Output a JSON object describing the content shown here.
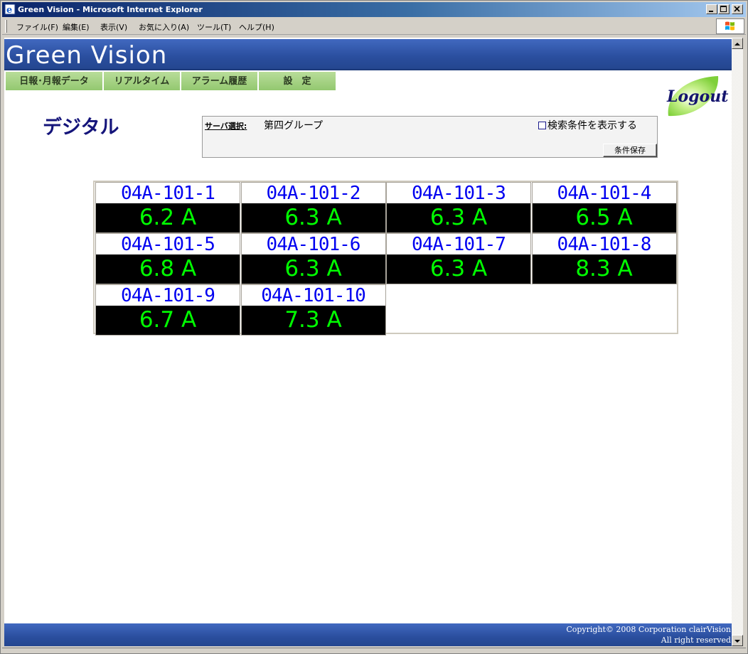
{
  "window": {
    "title": "Green Vision - Microsoft Internet Explorer"
  },
  "menubar": {
    "items": [
      "ファイル(F)",
      "編集(E)",
      "表示(V)",
      "お気に入り(A)",
      "ツール(T)",
      "ヘルプ(H)"
    ]
  },
  "header": {
    "title": "Green Vision"
  },
  "tabs": [
    {
      "label": "日報･月報データ"
    },
    {
      "label": "リアルタイム"
    },
    {
      "label": "アラーム履歴"
    },
    {
      "label": "設　定"
    }
  ],
  "logout": {
    "label": "Logout"
  },
  "page": {
    "title": "デジタル"
  },
  "search": {
    "server_label": "サーバ選択:",
    "server_value": "第四グループ",
    "show_conditions_label": "検索条件を表示する",
    "show_conditions_checked": false,
    "save_button": "条件保存"
  },
  "meters": [
    {
      "name": "04A-101-1",
      "value": "6.2 A"
    },
    {
      "name": "04A-101-2",
      "value": "6.3 A"
    },
    {
      "name": "04A-101-3",
      "value": "6.3 A"
    },
    {
      "name": "04A-101-4",
      "value": "6.5 A"
    },
    {
      "name": "04A-101-5",
      "value": "6.8 A"
    },
    {
      "name": "04A-101-6",
      "value": "6.3 A"
    },
    {
      "name": "04A-101-7",
      "value": "6.3 A"
    },
    {
      "name": "04A-101-8",
      "value": "8.3 A"
    },
    {
      "name": "04A-101-9",
      "value": "6.7 A"
    },
    {
      "name": "04A-101-10",
      "value": "7.3 A"
    }
  ],
  "footer": {
    "copyright_line1": "Copyright© 2008 Corporation clairVision",
    "copyright_line2": "All right reserved"
  },
  "colors": {
    "header_blue": "#2a4e9e",
    "tab_green": "#a8d488",
    "meter_name": "#0000f0",
    "meter_value": "#00ff00",
    "meter_bg": "#000000"
  }
}
